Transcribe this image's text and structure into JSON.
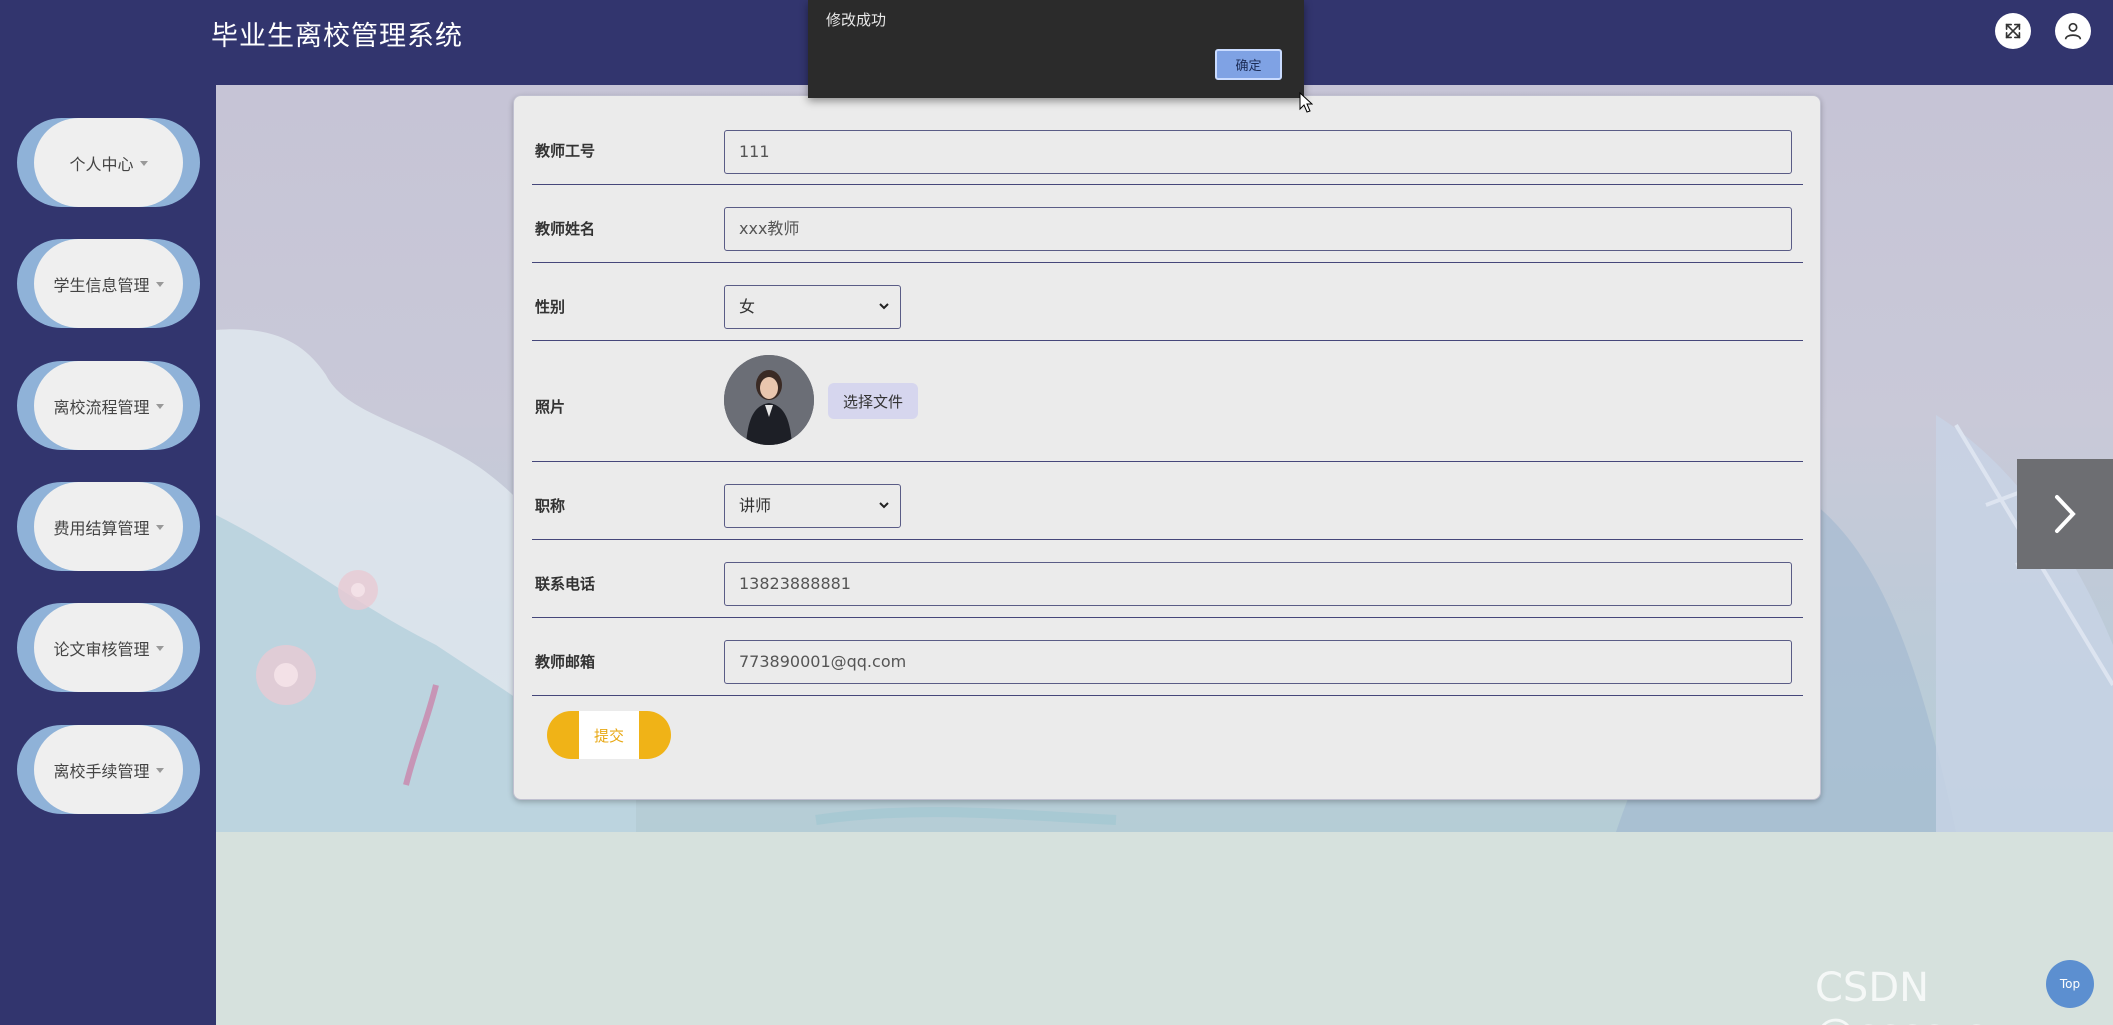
{
  "header": {
    "title": "毕业生离校管理系统",
    "fullscreen_icon": "expand-icon",
    "user_icon": "user-icon"
  },
  "sidebar": {
    "items": [
      {
        "label": "个人中心"
      },
      {
        "label": "学生信息管理"
      },
      {
        "label": "离校流程管理"
      },
      {
        "label": "费用结算管理"
      },
      {
        "label": "论文审核管理"
      },
      {
        "label": "离校手续管理"
      }
    ]
  },
  "alert": {
    "message": "修改成功",
    "ok_label": "确定"
  },
  "form": {
    "teacher_id": {
      "label": "教师工号",
      "value": "111"
    },
    "teacher_name": {
      "label": "教师姓名",
      "value": "xxx教师"
    },
    "gender": {
      "label": "性别",
      "value": "女"
    },
    "photo": {
      "label": "照片",
      "file_button": "选择文件"
    },
    "title": {
      "label": "职称",
      "value": "讲师"
    },
    "phone": {
      "label": "联系电话",
      "value": "13823888881"
    },
    "email": {
      "label": "教师邮箱",
      "value": "773890001@qq.com"
    },
    "submit_label": "提交"
  },
  "watermark": "CSDN @cccc_cz",
  "top_button": "Top",
  "colors": {
    "header_bg": "#32356e",
    "sidebar_pill": "#8fb2d8",
    "submit": "#f0b317",
    "alert_ok": "#7fa2e4"
  }
}
